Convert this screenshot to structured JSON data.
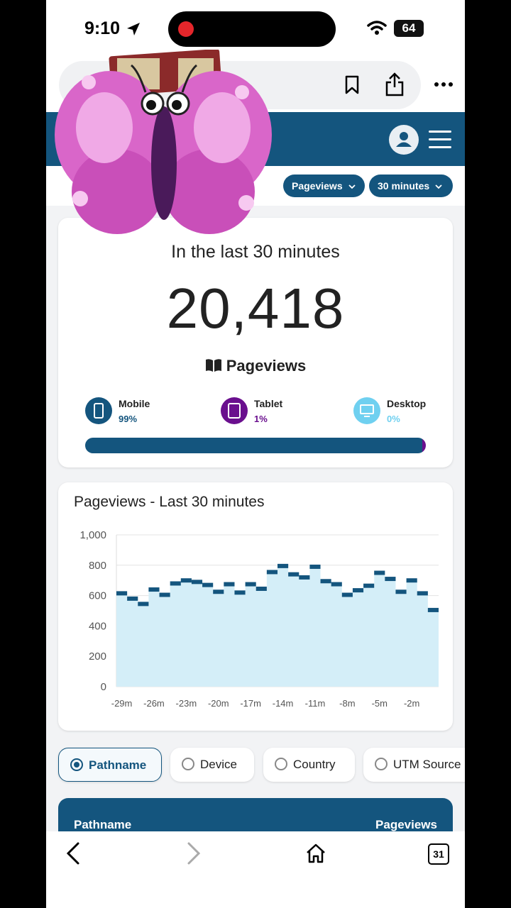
{
  "status": {
    "time": "9:10",
    "battery": "64"
  },
  "filters": {
    "metric": "Pageviews",
    "range": "30 minutes"
  },
  "summary": {
    "headline": "In the last 30 minutes",
    "total": "20,418",
    "metric_label": "Pageviews",
    "devices": [
      {
        "name": "Mobile",
        "pct": "99%",
        "color": "#14557e",
        "fraction": 0.99
      },
      {
        "name": "Tablet",
        "pct": "1%",
        "color": "#6a0f8e",
        "fraction": 0.01
      },
      {
        "name": "Desktop",
        "pct": "0%",
        "color": "#6fd0f0",
        "fraction": 0.0
      }
    ]
  },
  "chart_data": {
    "type": "area",
    "title": "Pageviews - Last 30 minutes",
    "x": [
      -29,
      -28,
      -27,
      -26,
      -25,
      -24,
      -23,
      -22,
      -21,
      -20,
      -19,
      -18,
      -17,
      -16,
      -15,
      -14,
      -13,
      -12,
      -11,
      -10,
      -9,
      -8,
      -7,
      -6,
      -5,
      -4,
      -3,
      -2,
      -1,
      0
    ],
    "values": [
      615,
      580,
      545,
      640,
      605,
      680,
      700,
      690,
      670,
      625,
      675,
      620,
      675,
      645,
      755,
      795,
      740,
      720,
      790,
      695,
      675,
      605,
      635,
      665,
      750,
      710,
      625,
      700,
      615,
      505
    ],
    "xtick_labels": [
      "-29m",
      "-26m",
      "-23m",
      "-20m",
      "-17m",
      "-14m",
      "-11m",
      "-8m",
      "-5m",
      "-2m"
    ],
    "ytick_labels": [
      "1,000",
      "800",
      "600",
      "400",
      "200",
      "0"
    ],
    "ylim": [
      0,
      1000
    ],
    "grid": true,
    "line_color": "#14557e",
    "fill_color": "#d4eef8"
  },
  "tabs": [
    {
      "label": "Pathname",
      "selected": true
    },
    {
      "label": "Device",
      "selected": false
    },
    {
      "label": "Country",
      "selected": false
    },
    {
      "label": "UTM Source",
      "selected": false
    }
  ],
  "table": {
    "col1": "Pathname",
    "col2": "Pageviews"
  },
  "toolbar": {
    "tabs_count": "31"
  },
  "colors": {
    "brand": "#14557e",
    "accent_orange": "#f0811e"
  }
}
